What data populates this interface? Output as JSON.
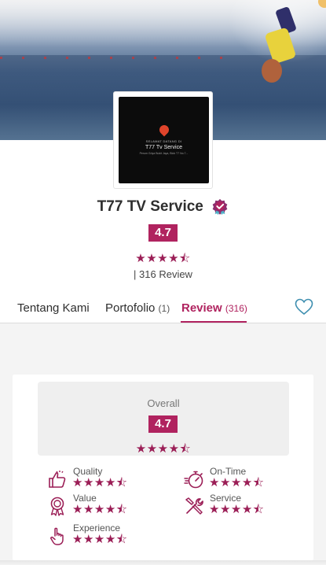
{
  "logo": {
    "welcome": "SELAMAT DATANG DI",
    "name": "T77 Tv Service",
    "address": "Perum Griya Bukit Jaya, Blok T7 No.7..."
  },
  "profile": {
    "name": "T77 TV Service",
    "rating": "4.7",
    "stars": "★★★★⯪",
    "review_count": "| 316 Review"
  },
  "tabs": [
    {
      "label": "Tentang Kami",
      "count": ""
    },
    {
      "label": "Portofolio",
      "count": "(1)"
    },
    {
      "label": "Review",
      "count": "(316)"
    }
  ],
  "overall": {
    "label": "Overall",
    "rating": "4.7",
    "stars": "★★★★⯪"
  },
  "criteria": [
    {
      "label": "Quality",
      "icon": "thumbs-up-icon",
      "stars": "★★★★⯪"
    },
    {
      "label": "On-Time",
      "icon": "stopwatch-icon",
      "stars": "★★★★⯪"
    },
    {
      "label": "Value",
      "icon": "award-icon",
      "stars": "★★★★⯪"
    },
    {
      "label": "Service",
      "icon": "tools-icon",
      "stars": "★★★★⯪"
    },
    {
      "label": "Experience",
      "icon": "hand-pointer-icon",
      "stars": "★★★★⯪"
    }
  ],
  "colors": {
    "accent": "#b0235f",
    "star": "#9b1e56"
  }
}
